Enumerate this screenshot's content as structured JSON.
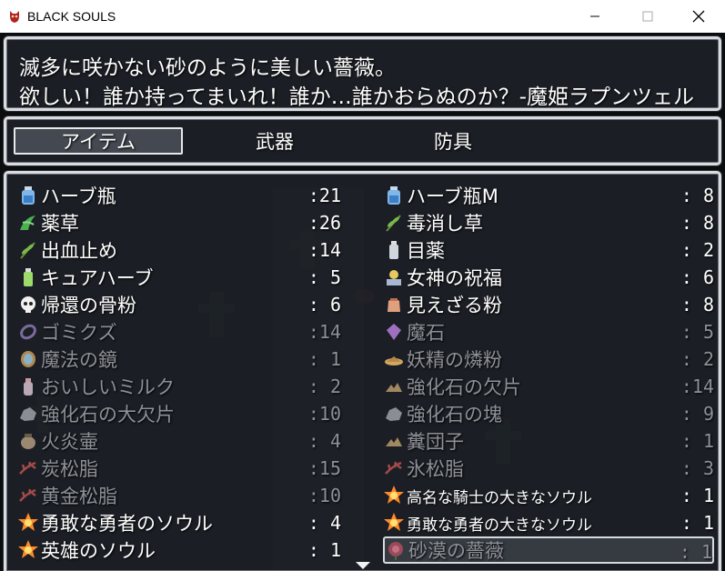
{
  "window": {
    "title": "BLACK SOULS"
  },
  "help": {
    "line1": "滅多に咲かない砂のように美しい薔薇。",
    "line2": "欲しい！誰か持ってまいれ！誰か…誰かおらぬのか？-魔姫ラプンツェル"
  },
  "tabs": [
    {
      "label": "アイテム",
      "selected": true
    },
    {
      "label": "武器",
      "selected": false
    },
    {
      "label": "防具",
      "selected": false
    }
  ],
  "items_left": [
    {
      "name": "ハーブ瓶",
      "count": ":21",
      "icon": "bottle-icon"
    },
    {
      "name": "薬草",
      "count": ":26",
      "icon": "herb-icon"
    },
    {
      "name": "出血止め",
      "count": ":14",
      "icon": "herb-sprig-icon"
    },
    {
      "name": "キュアハーブ",
      "count": ": 5",
      "icon": "green-vial-icon"
    },
    {
      "name": "帰還の骨粉",
      "count": ": 6",
      "icon": "skull-icon"
    },
    {
      "name": "ゴミクズ",
      "count": ":14",
      "icon": "rope-icon",
      "dim": true
    },
    {
      "name": "魔法の鏡",
      "count": ": 1",
      "icon": "mirror-icon",
      "dim": true
    },
    {
      "name": "おいしいミルク",
      "count": ": 2",
      "icon": "milk-bottle-icon",
      "dim": true
    },
    {
      "name": "強化石の大欠片",
      "count": ":10",
      "icon": "stone-icon",
      "dim": true
    },
    {
      "name": "火炎壷",
      "count": ": 4",
      "icon": "pot-icon",
      "dim": true
    },
    {
      "name": "炭松脂",
      "count": ":15",
      "icon": "resin-icon",
      "dim": true
    },
    {
      "name": "黄金松脂",
      "count": ":10",
      "icon": "resin-icon",
      "dim": true
    },
    {
      "name": "勇敢な勇者のソウル",
      "count": ": 4",
      "icon": "soul-icon"
    },
    {
      "name": "英雄のソウル",
      "count": ": 1",
      "icon": "soul-icon"
    }
  ],
  "items_right": [
    {
      "name": "ハーブ瓶M",
      "count": ": 8",
      "icon": "bottle-icon"
    },
    {
      "name": "毒消し草",
      "count": ": 8",
      "icon": "herb-sprig-icon"
    },
    {
      "name": "目薬",
      "count": ": 2",
      "icon": "vial-icon"
    },
    {
      "name": "女神の祝福",
      "count": ": 6",
      "icon": "blessing-icon"
    },
    {
      "name": "見えざる粉",
      "count": ": 8",
      "icon": "powder-bag-icon"
    },
    {
      "name": "魔石",
      "count": ": 5",
      "icon": "gem-icon",
      "dim": true
    },
    {
      "name": "妖精の燐粉",
      "count": ": 2",
      "icon": "dust-icon",
      "dim": true
    },
    {
      "name": "強化石の欠片",
      "count": ":14",
      "icon": "shards-icon",
      "dim": true
    },
    {
      "name": "強化石の塊",
      "count": ": 9",
      "icon": "stone-icon",
      "dim": true
    },
    {
      "name": "糞団子",
      "count": ": 1",
      "icon": "shards-icon",
      "dim": true
    },
    {
      "name": "氷松脂",
      "count": ": 3",
      "icon": "resin-icon",
      "dim": true
    },
    {
      "name": "高名な騎士の大きなソウル",
      "count": ": 1",
      "icon": "soul-icon",
      "small": true
    },
    {
      "name": "勇敢な勇者の大きなソウル",
      "count": ": 1",
      "icon": "soul-icon",
      "small": true
    },
    {
      "name": "砂漠の薔薇",
      "count": ": 1",
      "icon": "rose-icon",
      "dim": true,
      "cursor": true
    }
  ]
}
